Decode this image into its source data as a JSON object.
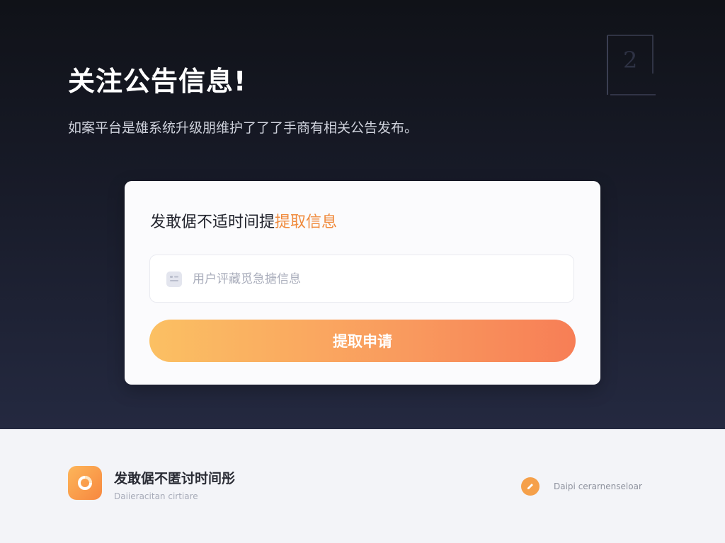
{
  "hero": {
    "title": "关注公告信息!",
    "subtitle": "如案平台是雄系统升级朋维护了了了手商有相关公告发布。",
    "corner_mark_icon": "bracket-digit-icon"
  },
  "card": {
    "title_main": "发敢倨不适时间提",
    "title_accent": "提取信息",
    "accent_color": "#f08a3c",
    "input": {
      "icon": "id-card-icon",
      "placeholder": "用户评藏觅急搪信息",
      "value": ""
    },
    "submit_label": "提取申请",
    "button_gradient": [
      "#fbc063",
      "#f77e56"
    ]
  },
  "footer": {
    "app_icon": "orange-ring-app-icon",
    "title": "发敢倨不匿讨时间彤",
    "caption": "Daiieracitan cirtiare",
    "link_icon": "pencil-icon",
    "link_text": "Daipi cerarnenseloar"
  }
}
